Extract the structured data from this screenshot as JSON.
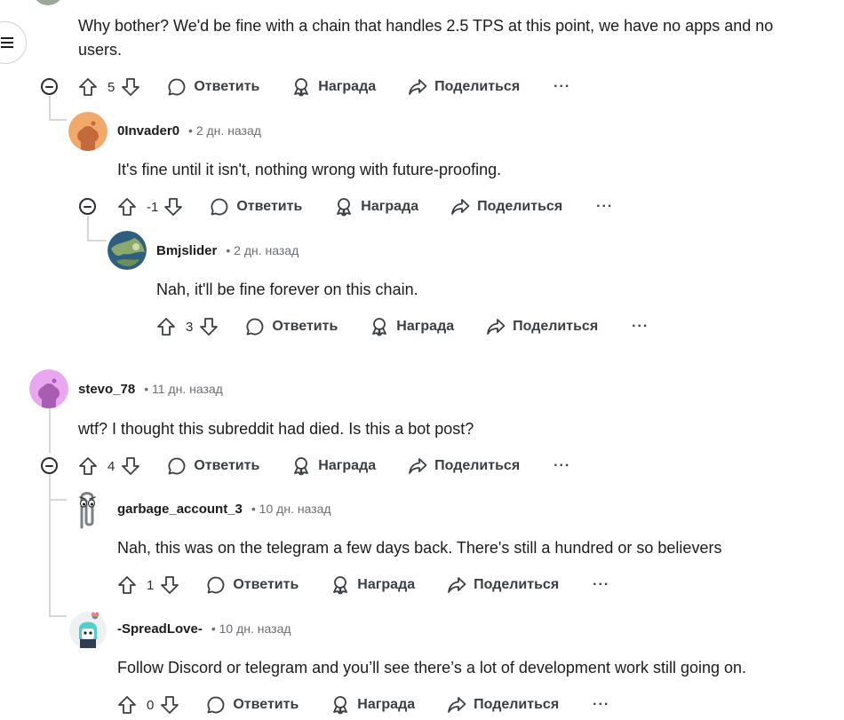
{
  "actions": {
    "reply": "Ответить",
    "award": "Награда",
    "share": "Поделиться",
    "more": "···"
  },
  "comments": [
    {
      "text_lines": [
        "Why bother? We'd be fine with a chain that handles 2.5 TPS at this point, we have no apps and no",
        "users."
      ],
      "votes": "5"
    },
    {
      "username": "0Invader0",
      "time": "• 2 дн. назад",
      "text": "It's fine until it isn't, nothing wrong with future-proofing.",
      "votes": "-1",
      "avatar_color": "#f0a86b"
    },
    {
      "username": "Bmjslider",
      "time": "• 2 дн. назад",
      "text": "Nah, it'll be fine forever on this chain.",
      "votes": "3",
      "avatar_color": "#3a6e8f"
    },
    {
      "username": "stevo_78",
      "time": "• 11 дн. назад",
      "text": "wtf? I thought this subreddit had died. Is this a bot post?",
      "votes": "4",
      "avatar_color": "#e9a7f0"
    },
    {
      "username": "garbage_account_3",
      "time": "• 10 дн. назад",
      "text": "Nah, this was on the telegram a few days back. There's still a hundred or so believers",
      "votes": "1"
    },
    {
      "username": "-SpreadLove-",
      "time": "• 10 дн. назад",
      "text": "Follow Discord or telegram and you’ll see there’s a lot of development work still going on.",
      "votes": "0"
    }
  ],
  "colors": {
    "thread_line": "#d5d8db",
    "text": "#1c1c1c",
    "meta": "#6b6f73",
    "action": "#3a3f44"
  }
}
